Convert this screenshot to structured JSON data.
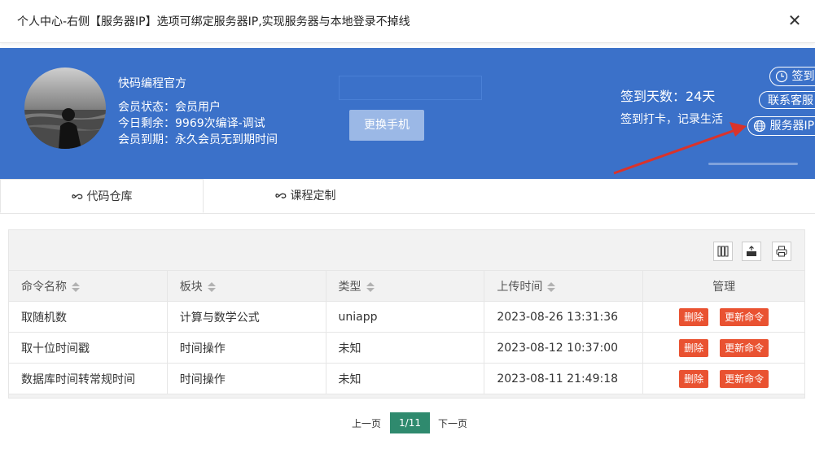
{
  "dialog": {
    "title": "个人中心-右侧【服务器IP】选项可绑定服务器IP,实现服务器与本地登录不掉线",
    "close_symbol": "✕"
  },
  "profile": {
    "username": "快码编程官方",
    "status_label": "会员状态：",
    "status_value": "会员用户",
    "remaining_label": "今日剩余：",
    "remaining_value": "9969次编译-调试",
    "expiry_label": "会员到期：",
    "expiry_value": "永久会员无到期时间",
    "change_phone_button": "更换手机"
  },
  "checkin": {
    "days_text": "签到天数：24天",
    "slogan": "签到打卡，记录生活",
    "signin_button": "签到",
    "contact_button": "联系客服",
    "server_ip_button": "服务器IP"
  },
  "tabs": [
    {
      "label": "代码仓库",
      "icon": "link-icon",
      "active": true
    },
    {
      "label": "课程定制",
      "icon": "link-icon",
      "active": false
    }
  ],
  "toolbar": {
    "icons": [
      "columns-icon",
      "export-icon",
      "print-icon"
    ]
  },
  "table": {
    "columns": [
      "命令名称",
      "板块",
      "类型",
      "上传时间",
      "管理"
    ],
    "rows": [
      {
        "name": "取随机数",
        "section": "计算与数学公式",
        "type": "uniapp",
        "time": "2023-08-26 13:31:36"
      },
      {
        "name": "取十位时间戳",
        "section": "时间操作",
        "type": "未知",
        "time": "2023-08-12 10:37:00"
      },
      {
        "name": "数据库时间转常规时间",
        "section": "时间操作",
        "type": "未知",
        "time": "2023-08-11 21:49:18"
      }
    ],
    "delete_label": "删除",
    "update_label": "更新命令"
  },
  "pager": {
    "prev": "上一页",
    "current": "1/11",
    "next": "下一页"
  },
  "colors": {
    "banner": "#3b71c9",
    "danger": "#e95231",
    "pager_active": "#2f8a6e",
    "arrow": "#d9332b"
  }
}
